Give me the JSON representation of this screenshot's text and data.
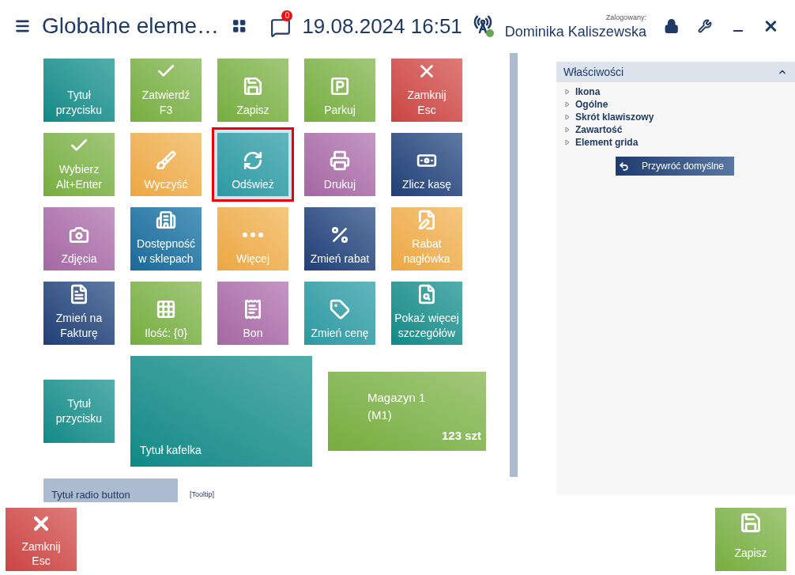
{
  "header": {
    "title": "Globalne eleme…",
    "notifications": "0",
    "datetime": "19.08.2024 16:51",
    "logged_label": "Zalogowany:",
    "user": "Dominika Kaliszewska"
  },
  "tiles": [
    {
      "label": "Tytuł\nprzycisku",
      "selected": false
    },
    {
      "label": "Zatwierdź\nF3",
      "selected": false
    },
    {
      "label": "Zapisz",
      "selected": false
    },
    {
      "label": "Parkuj",
      "selected": false
    },
    {
      "label": "Zamknij\nEsc",
      "selected": false
    },
    {
      "label": "Wybierz\nAlt+Enter",
      "selected": false
    },
    {
      "label": "Wyczyść",
      "selected": false
    },
    {
      "label": "Odśwież",
      "selected": true
    },
    {
      "label": "Drukuj",
      "selected": false
    },
    {
      "label": "Zlicz kasę",
      "selected": false
    },
    {
      "label": "Zdjęcia",
      "selected": false
    },
    {
      "label": "Dostępność\nw sklepach",
      "selected": false
    },
    {
      "label": "Więcej",
      "selected": false
    },
    {
      "label": "Zmień rabat",
      "selected": false
    },
    {
      "label": "Rabat\nnagłówka",
      "selected": false
    },
    {
      "label": "Zmień na\nFakturę",
      "selected": false
    },
    {
      "label": "Ilość: {0}",
      "selected": false
    },
    {
      "label": "Bon",
      "selected": false
    },
    {
      "label": "Zmień cenę",
      "selected": false
    },
    {
      "label": "Pokaż więcej\nszczegółów",
      "selected": false
    }
  ],
  "small_tile": {
    "label": "Tytuł\nprzycisku"
  },
  "large_tile": {
    "label": "Tytuł kafelka"
  },
  "warehouse_tile": {
    "name": "Magazyn 1",
    "code": "(M1)",
    "quantity": "123 szt"
  },
  "radio_tile": {
    "label": "Tytuł radio button"
  },
  "tooltip": "[Tooltip]",
  "properties": {
    "title": "Właściwości",
    "expanded": true,
    "items": [
      {
        "label": "Ikona",
        "expanded": false
      },
      {
        "label": "Ogólne",
        "expanded": false
      },
      {
        "label": "Skrót klawiszowy",
        "expanded": false
      },
      {
        "label": "Zawartość",
        "expanded": false
      },
      {
        "label": "Element grida",
        "expanded": false
      }
    ],
    "restore_button": "Przywróć domyślne"
  },
  "footer": {
    "close_button": "Zamknij\nEsc",
    "save_button": "Zapisz"
  }
}
